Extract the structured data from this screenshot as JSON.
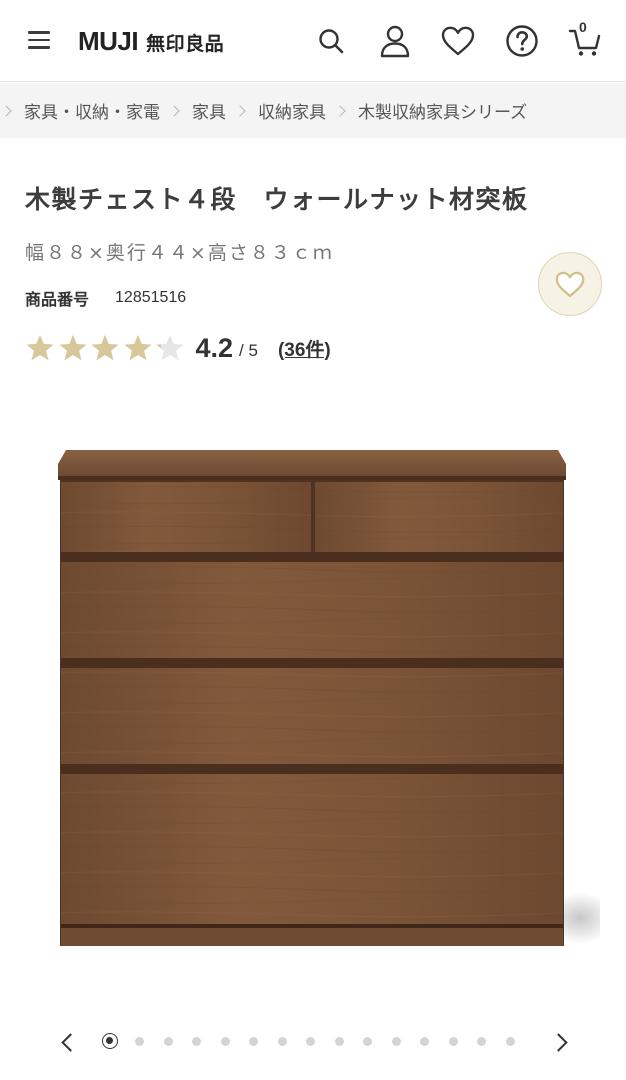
{
  "header": {
    "logo_en": "MUJI",
    "logo_jp": "無印良品",
    "cart_count": "0",
    "icons": [
      "menu-icon",
      "search-icon",
      "account-icon",
      "heart-icon",
      "help-icon",
      "cart-icon"
    ]
  },
  "breadcrumb": [
    "家具・収納・家電",
    "家具",
    "収納家具",
    "木製収納家具シリーズ"
  ],
  "product": {
    "title": "木製チェスト４段　ウォールナット材突板",
    "size": "幅８８×奥行４４×高さ８３ｃｍ",
    "number_label": "商品番号",
    "number": "12851516",
    "rating": {
      "score": "4.2",
      "out_of": "/ 5",
      "reviews": "(36件)",
      "value": 4.2,
      "max": 5
    }
  },
  "carousel": {
    "total": 15,
    "active": 1
  },
  "colors": {
    "star_filled": "#d9c79c",
    "star_empty": "#e6e6e6",
    "fav_bg": "#f7f2e6",
    "fav_border": "#e2d4b0",
    "wood": "#7a5438"
  }
}
